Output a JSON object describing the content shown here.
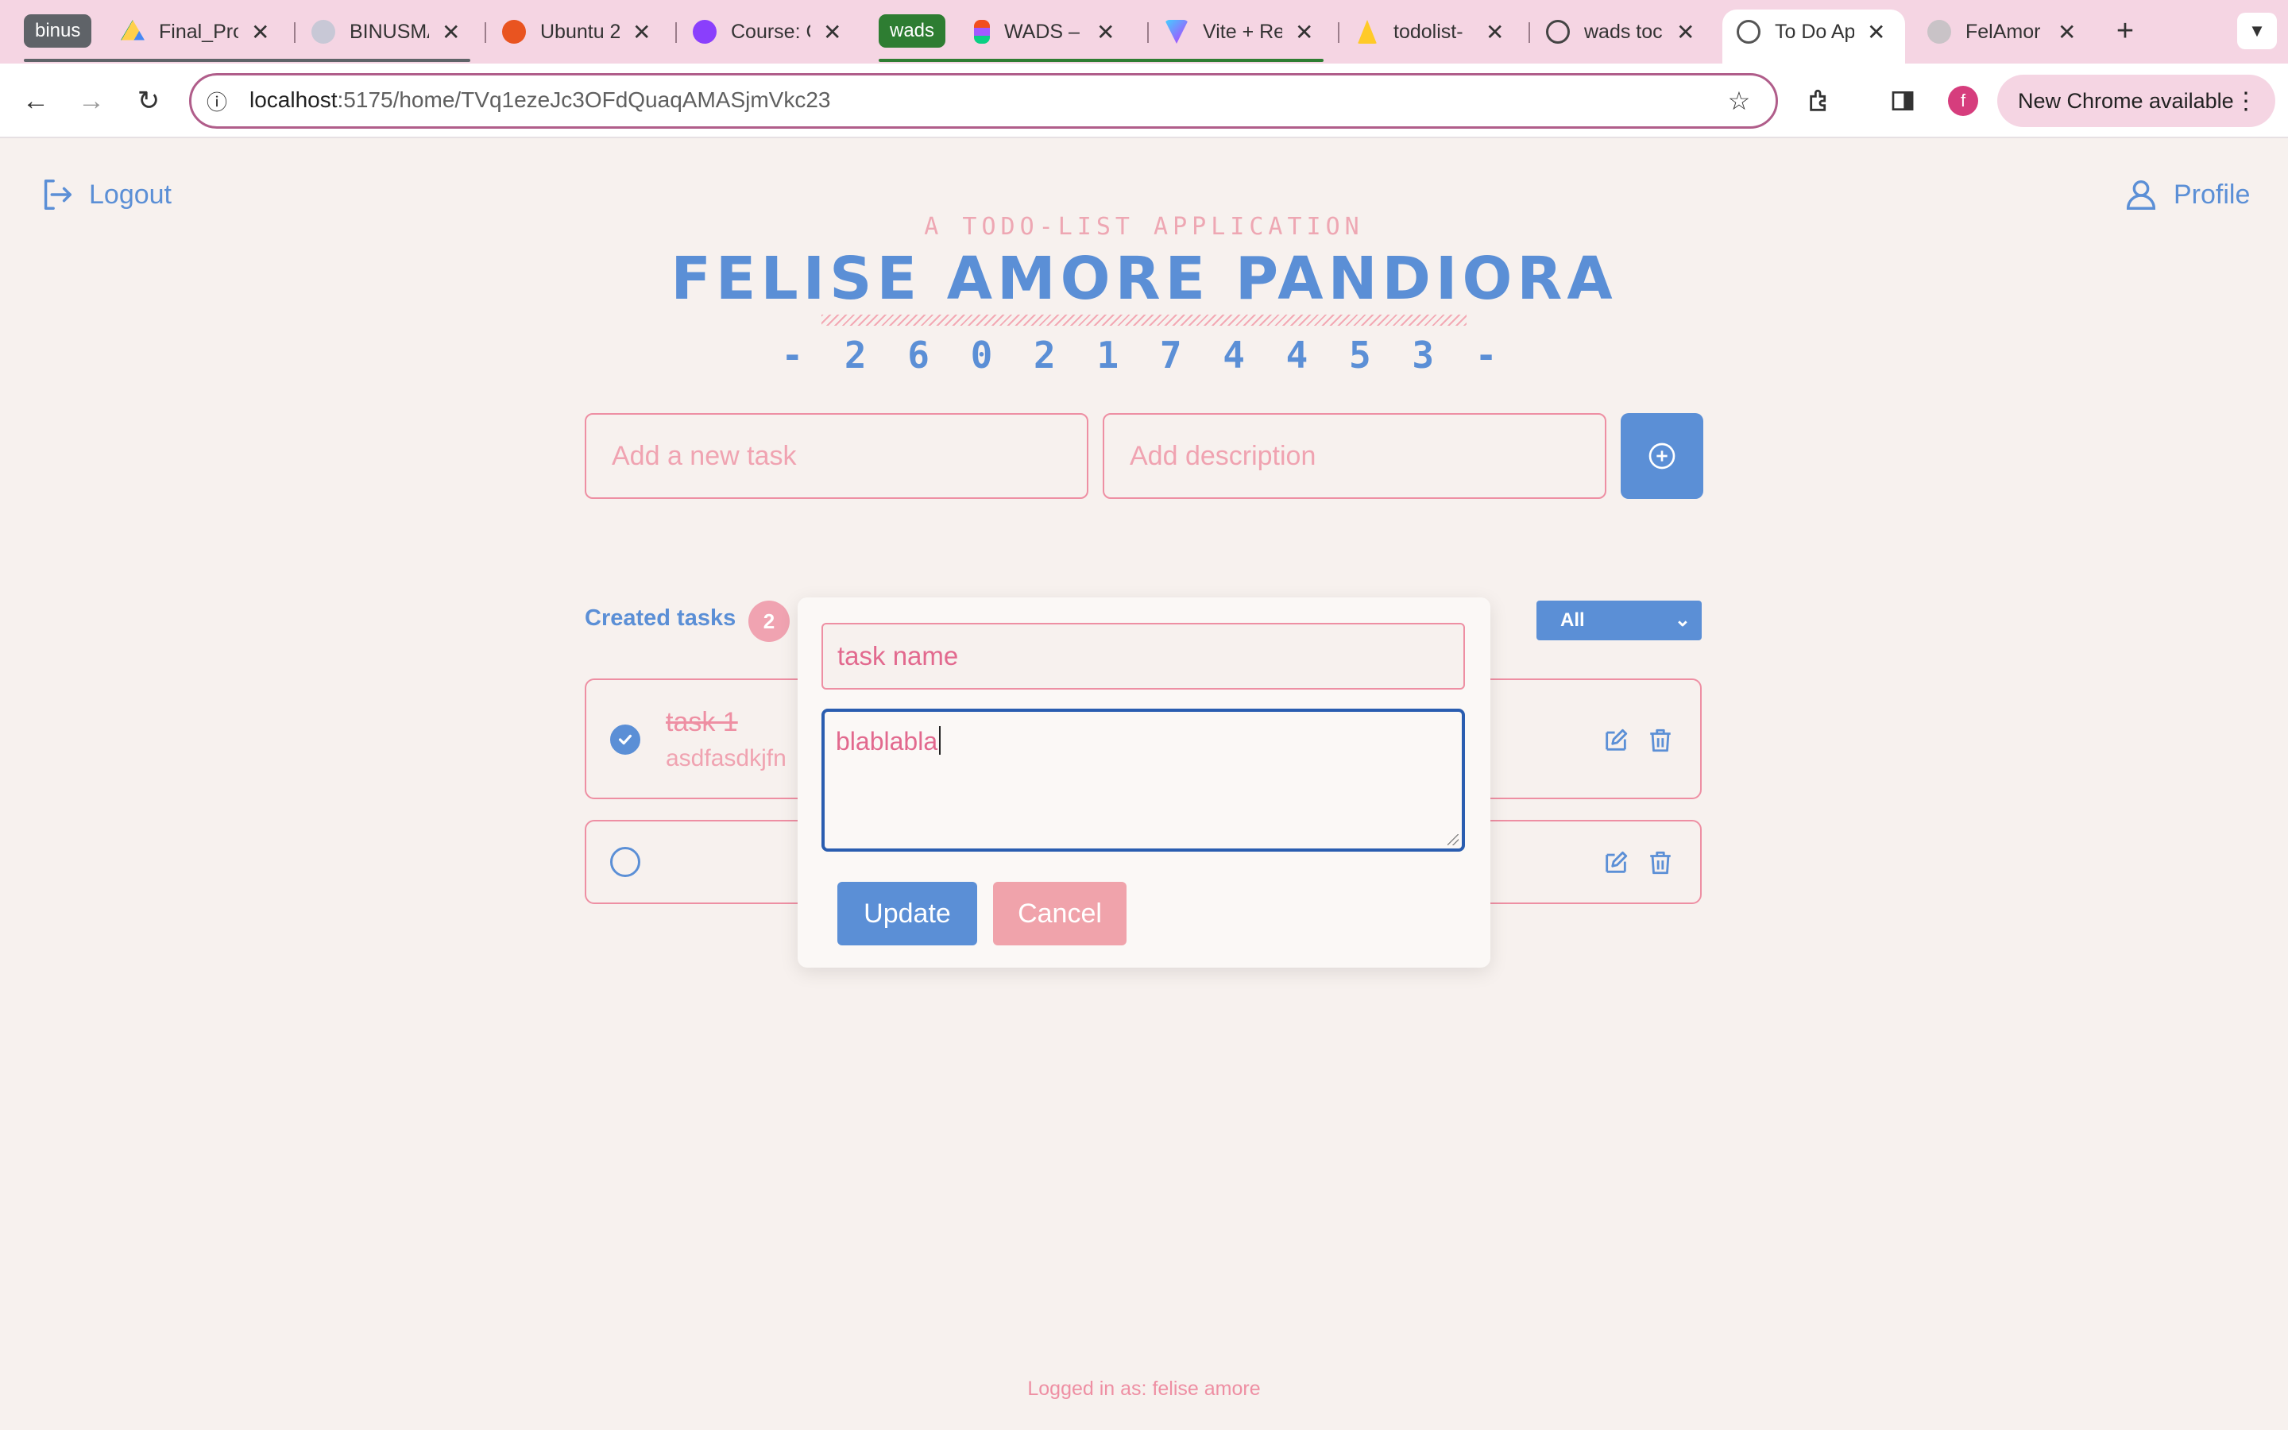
{
  "browser": {
    "tab_group_1": "binus",
    "tab_group_2": "wads",
    "tabs": [
      {
        "title": "Final_Pro"
      },
      {
        "title": "BINUSMA"
      },
      {
        "title": "Ubuntu 2"
      },
      {
        "title": "Course: C"
      },
      {
        "title": "WADS –"
      },
      {
        "title": "Vite + Re"
      },
      {
        "title": "todolist-"
      },
      {
        "title": "wads toc"
      },
      {
        "title": "To Do Ap"
      },
      {
        "title": "FelAmor"
      }
    ],
    "url_host": "localhost",
    "url_rest": ":5175/home/TVq1ezeJc3OFdQuaqAMASjmVkc23",
    "update_label": "New Chrome available",
    "profile_initial": "f"
  },
  "nav": {
    "logout_label": "Logout",
    "profile_label": "Profile"
  },
  "header": {
    "subtitle": "A TODO-LIST APPLICATION",
    "title": "FELISE AMORE PANDIORA",
    "nim": "- 2 6 0 2 1 7 4 4 5 3 -"
  },
  "add_form": {
    "task_placeholder": "Add a new task",
    "desc_placeholder": "Add description"
  },
  "tasks_section": {
    "label": "Created tasks",
    "count": "2",
    "filter_value": "All",
    "tasks": [
      {
        "title": "task 1",
        "description": "asdfasdkjfn",
        "completed": true
      },
      {
        "title": "",
        "description": "",
        "completed": false
      }
    ]
  },
  "edit_modal": {
    "name_placeholder": "task name",
    "desc_value": "blablabla",
    "update_label": "Update",
    "cancel_label": "Cancel"
  },
  "footer": {
    "logged_in": "Logged in as: felise amore"
  },
  "colors": {
    "accent_blue": "#5b8fd6",
    "accent_pink": "#ee8fa3",
    "background": "#f7f1ee",
    "chrome_pink": "#f5d5e3"
  }
}
